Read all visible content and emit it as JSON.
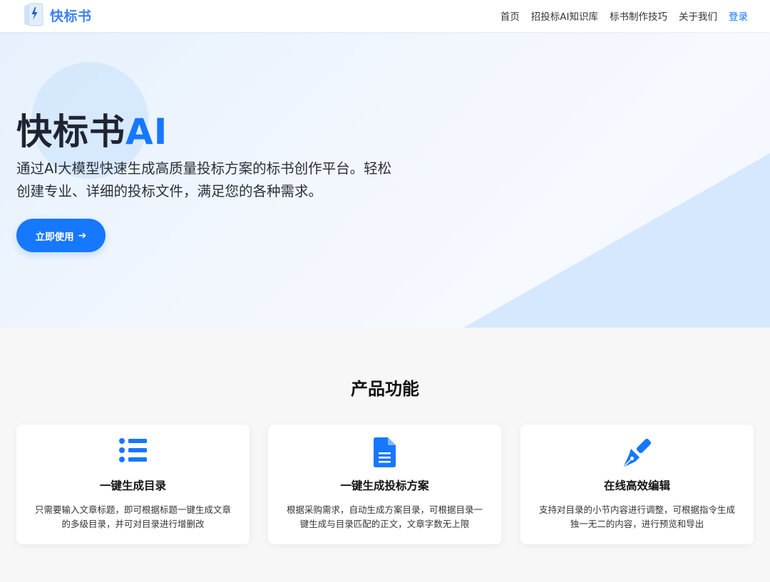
{
  "brand": {
    "name": "快标书",
    "accent": "#1677ff"
  },
  "nav": {
    "links": [
      "首页",
      "招投标AI知识库",
      "标书制作技巧",
      "关于我们"
    ],
    "login": "登录"
  },
  "hero": {
    "title_main": "快标书",
    "title_accent": "AI",
    "description": "通过AI大模型快速生成高质量投标方案的标书创作平台。轻松创建专业、详细的投标文件，满足您的各种需求。",
    "cta_label": "立即使用",
    "cta_icon": "arrow-right-icon"
  },
  "features": {
    "title": "产品功能",
    "cards": [
      {
        "icon": "list-icon",
        "title": "一键生成目录",
        "desc": "只需要输入文章标题，即可根据标题一键生成文章的多级目录，并可对目录进行增删改"
      },
      {
        "icon": "document-icon",
        "title": "一键生成投标方案",
        "desc": "根据采购需求，自动生成方案目录，可根据目录一键生成与目录匹配的正文，文章字数无上限"
      },
      {
        "icon": "pen-nib-icon",
        "title": "在线高效编辑",
        "desc": "支持对目录的小节内容进行调整，可根据指令生成独一无二的内容，进行预览和导出"
      }
    ]
  }
}
